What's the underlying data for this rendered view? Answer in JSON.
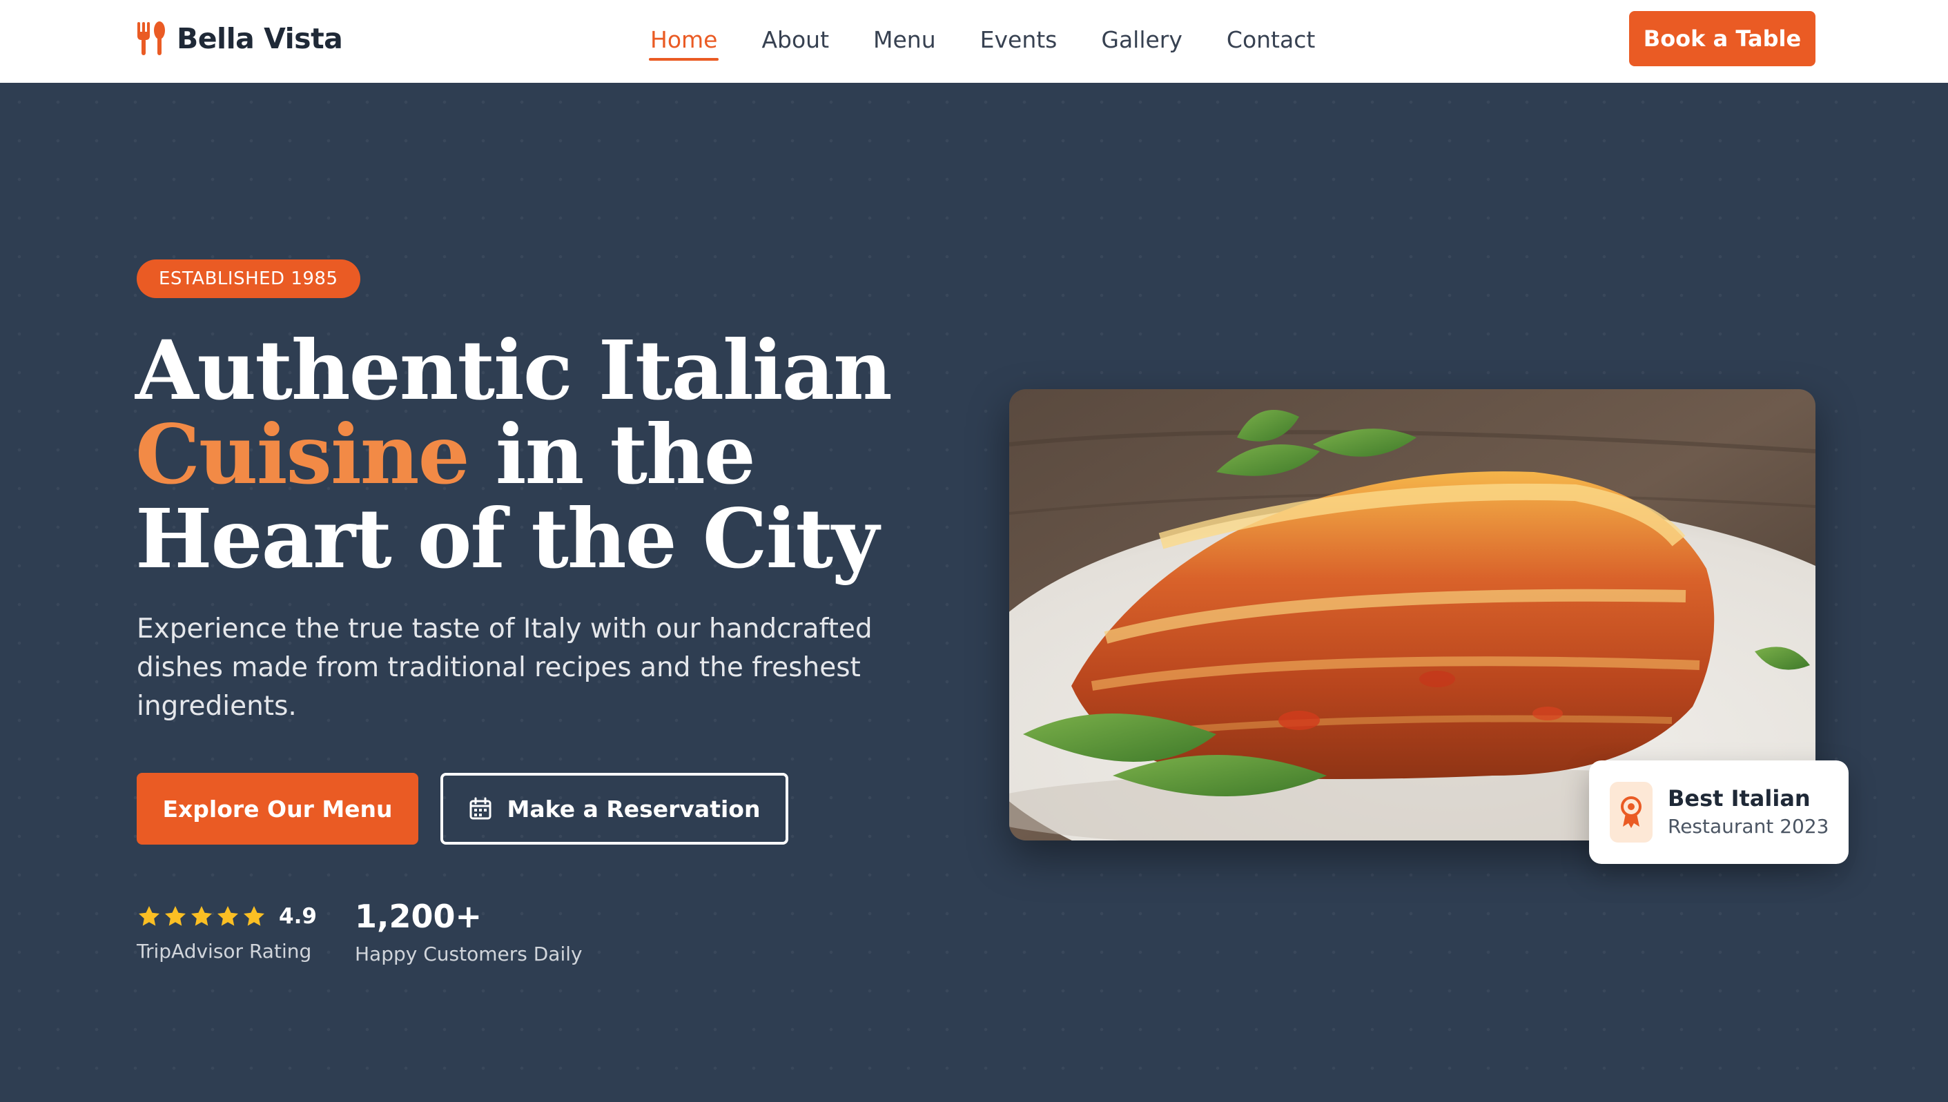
{
  "brand": {
    "name": "Bella Vista",
    "accent_color": "#ea5b24",
    "icon": "fork-spoon-icon"
  },
  "nav": {
    "items": [
      {
        "label": "Home",
        "active": true
      },
      {
        "label": "About",
        "active": false
      },
      {
        "label": "Menu",
        "active": false
      },
      {
        "label": "Events",
        "active": false
      },
      {
        "label": "Gallery",
        "active": false
      },
      {
        "label": "Contact",
        "active": false
      }
    ],
    "cta_label": "Book a Table"
  },
  "hero": {
    "badge": "ESTABLISHED 1985",
    "headline_part1": "Authentic Italian",
    "headline_accent": "Cuisine",
    "headline_part2": " in the Heart of the City",
    "subtext": "Experience the true taste of Italy with our handcrafted dishes made from traditional recipes and the freshest ingredients.",
    "primary_button": "Explore Our Menu",
    "secondary_button": "Make a Reservation",
    "secondary_button_icon": "calendar-icon",
    "background_color": "#2f3e52"
  },
  "stats": {
    "rating": {
      "stars": 5,
      "value": "4.9",
      "label": "TripAdvisor Rating"
    },
    "customers": {
      "value": "1,200+",
      "label": "Happy Customers Daily"
    }
  },
  "feature_image": {
    "subject": "lasagna-image"
  },
  "award": {
    "title": "Best Italian",
    "subtitle": "Restaurant 2023",
    "icon": "award-ribbon-icon"
  }
}
